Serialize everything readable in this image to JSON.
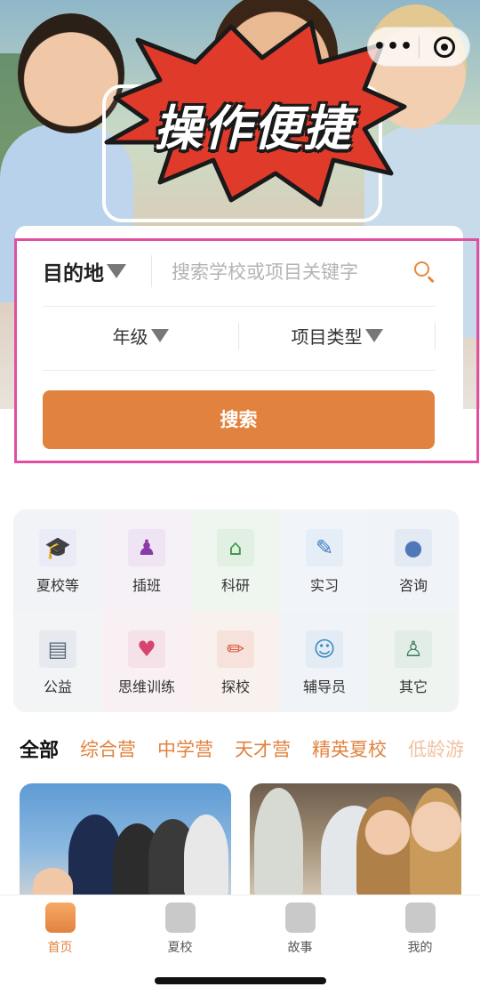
{
  "hero": {
    "promo_text": "操作便捷"
  },
  "capsule": {
    "more_icon": "more-dots-icon",
    "close_icon": "target-close-icon"
  },
  "search": {
    "destination_label": "目的地",
    "keyword_placeholder": "搜索学校或项目关键字",
    "grade_label": "年级",
    "type_label": "项目类型",
    "button_label": "搜索"
  },
  "categories": [
    {
      "label": "夏校等",
      "icon": "graduation-cap-icon",
      "color": "#4a5bc4"
    },
    {
      "label": "插班",
      "icon": "teacher-podium-icon",
      "color": "#8a3aa6"
    },
    {
      "label": "科研",
      "icon": "school-building-icon",
      "color": "#3f9a4e"
    },
    {
      "label": "实习",
      "icon": "stamp-icon",
      "color": "#3b7bc0"
    },
    {
      "label": "咨询",
      "icon": "consultant-icon",
      "color": "#5078b8"
    },
    {
      "label": "公益",
      "icon": "document-pen-icon",
      "color": "#5b6b7a"
    },
    {
      "label": "思维训练",
      "icon": "heart-shield-icon",
      "color": "#d6456f"
    },
    {
      "label": "探校",
      "icon": "pencil-icon",
      "color": "#d9573a"
    },
    {
      "label": "辅导员",
      "icon": "mentor-icon",
      "color": "#3b8ac0"
    },
    {
      "label": "其它",
      "icon": "person-book-icon",
      "color": "#3c7a5c"
    }
  ],
  "filter_tabs": [
    "全部",
    "综合营",
    "中学营",
    "天才营",
    "精英夏校",
    "低龄游"
  ],
  "tabbar": [
    {
      "label": "首页",
      "icon": "home-icon",
      "active": true
    },
    {
      "label": "夏校",
      "icon": "school-cap-icon",
      "active": false
    },
    {
      "label": "故事",
      "icon": "heart-chat-icon",
      "active": false
    },
    {
      "label": "我的",
      "icon": "profile-icon",
      "active": false
    }
  ],
  "colors": {
    "accent": "#e2823f",
    "highlight_outline": "#e24fa2",
    "burst_red": "#e03a2b"
  }
}
